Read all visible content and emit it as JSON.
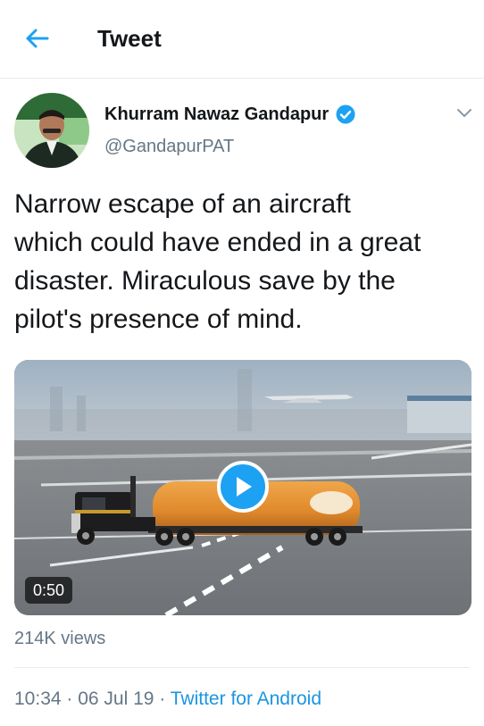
{
  "header": {
    "title": "Tweet",
    "back_icon": "back-arrow-icon"
  },
  "tweet": {
    "author_name": "Khurram Nawaz Gandapur",
    "author_handle": "@GandapurPAT",
    "verified": true,
    "text": "Narrow escape of an aircraft\nwhich could have ended in a great\ndisaster. Miraculous save by the\npilot's presence of mind.",
    "media": {
      "type": "video",
      "duration": "0:50"
    },
    "views": "214K views",
    "time": "10:34",
    "separator": " · ",
    "date": "06 Jul 19",
    "source": "Twitter for Android"
  },
  "colors": {
    "accent": "#1da1f2",
    "muted_text": "#657786",
    "border": "#e6ecf0"
  }
}
